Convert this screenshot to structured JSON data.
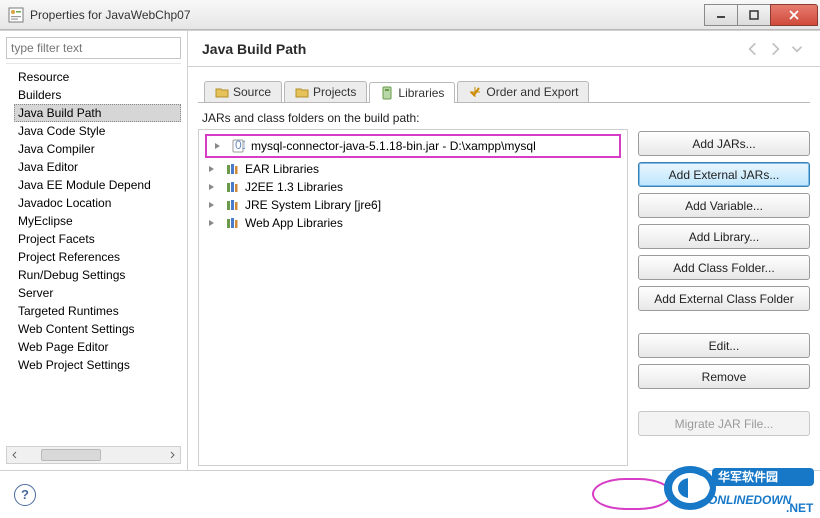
{
  "window": {
    "title": "Properties for JavaWebChp07"
  },
  "filter": {
    "placeholder": "type filter text"
  },
  "pageTitle": "Java Build Path",
  "treeItems": [
    "Resource",
    "Builders",
    "Java Build Path",
    "Java Code Style",
    "Java Compiler",
    "Java Editor",
    "Java EE Module Depend",
    "Javadoc Location",
    "MyEclipse",
    "Project Facets",
    "Project References",
    "Run/Debug Settings",
    "Server",
    "Targeted Runtimes",
    "Web Content Settings",
    "Web Page Editor",
    "Web Project Settings"
  ],
  "selectedTreeIndex": 2,
  "tabs": [
    {
      "label": "Source"
    },
    {
      "label": "Projects"
    },
    {
      "label": "Libraries"
    },
    {
      "label": "Order and Export"
    }
  ],
  "activeTabIndex": 2,
  "listLabel": "JARs and class folders on the build path:",
  "jars": [
    {
      "text": "mysql-connector-java-5.1.18-bin.jar - D:\\xampp\\mysql",
      "highlighted": true,
      "kind": "jar"
    },
    {
      "text": "EAR Libraries",
      "kind": "lib"
    },
    {
      "text": "J2EE 1.3 Libraries",
      "kind": "lib"
    },
    {
      "text": "JRE System Library [jre6]",
      "kind": "lib"
    },
    {
      "text": "Web App Libraries",
      "kind": "lib"
    }
  ],
  "buttons": {
    "addJars": "Add JARs...",
    "addExternalJars": "Add External JARs...",
    "addVariable": "Add Variable...",
    "addLibrary": "Add Library...",
    "addClassFolder": "Add Class Folder...",
    "addExternalClassFolder": "Add External Class Folder",
    "edit": "Edit...",
    "remove": "Remove",
    "migrate": "Migrate JAR File..."
  },
  "watermark": {
    "line1": "华军软件园",
    "line2": "ONLINEDOWN",
    "suffix": ".NET"
  }
}
